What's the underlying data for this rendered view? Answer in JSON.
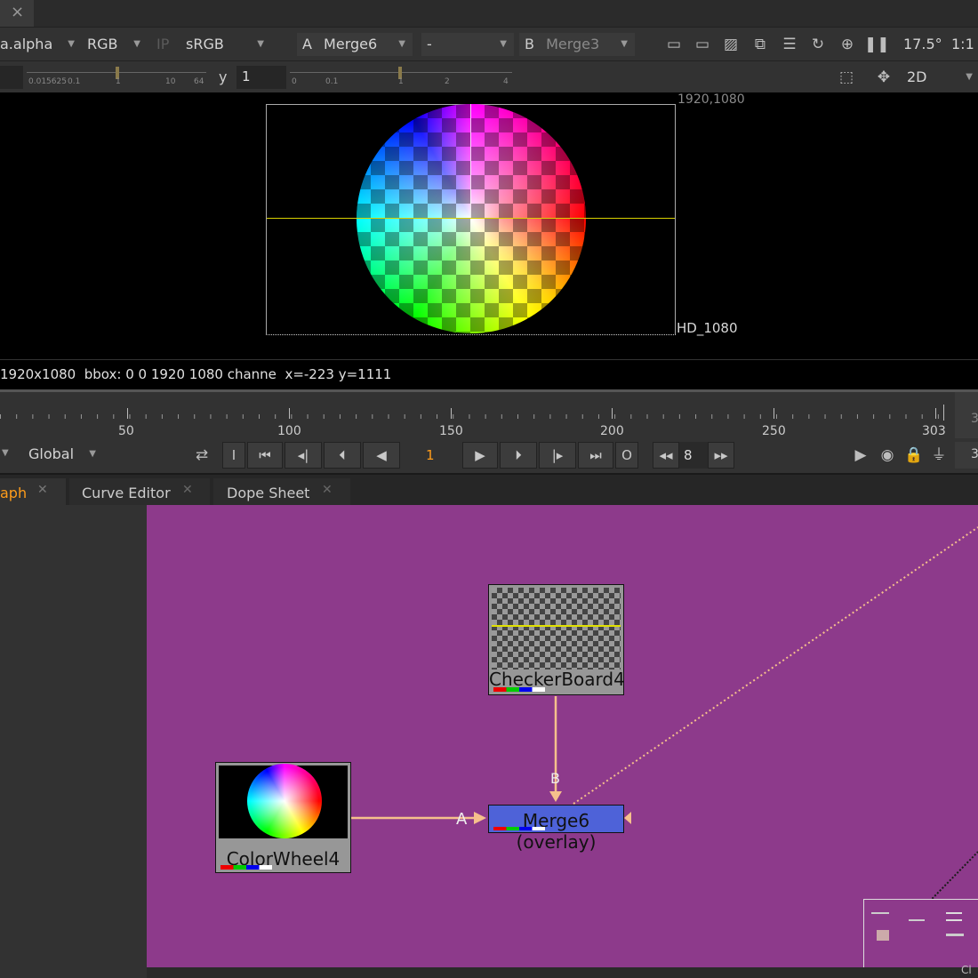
{
  "top_bar": {
    "close_label": "×"
  },
  "viewer_toolbar": {
    "channels": "a.alpha",
    "color": "RGB",
    "ip": "IP",
    "lut": "sRGB",
    "a_label": "A",
    "a_input": "Merge6",
    "wipe_mode": "-",
    "b_label": "B",
    "b_input": "Merge3",
    "zoom": "17.5°",
    "ratio": "1:1"
  },
  "viewer_toolbar2": {
    "gain_ticks": [
      "0.015625",
      "0.1",
      "1",
      "10",
      "64"
    ],
    "y_label": "y",
    "y_value": "1",
    "gamma_ticks": [
      "0",
      "0.1",
      "1",
      "2",
      "4"
    ],
    "view_mode": "2D"
  },
  "viewer": {
    "top_right_label": "1920,1080",
    "format_label": "HD_1080",
    "status": "1920x1080  bbox: 0 0 1920 1080 channe  x=-223 y=1111"
  },
  "timeline": {
    "tick_labels": [
      "50",
      "100",
      "150",
      "200",
      "250",
      "303"
    ],
    "end_partial": "3",
    "scope": "Global",
    "current_frame": "1",
    "step": "8",
    "btn_in": "I",
    "btn_out": "O",
    "end_partial2": "3"
  },
  "tabs": [
    {
      "label": "aph",
      "active": true
    },
    {
      "label": "Curve Editor",
      "active": false
    },
    {
      "label": "Dope Sheet",
      "active": false
    }
  ],
  "node_graph": {
    "background": "#8d3a8b",
    "nodes": {
      "checkerboard": "CheckerBoard4",
      "colorwheel": "ColorWheel4",
      "merge": "Merge6 (overlay)"
    },
    "input_a": "A",
    "input_b": "B",
    "minimap_partial": "Cl"
  },
  "colors": {
    "accent_orange": "#ff9c1a",
    "pipe": "#f6c08c",
    "merge_node": "#4e62d8"
  }
}
